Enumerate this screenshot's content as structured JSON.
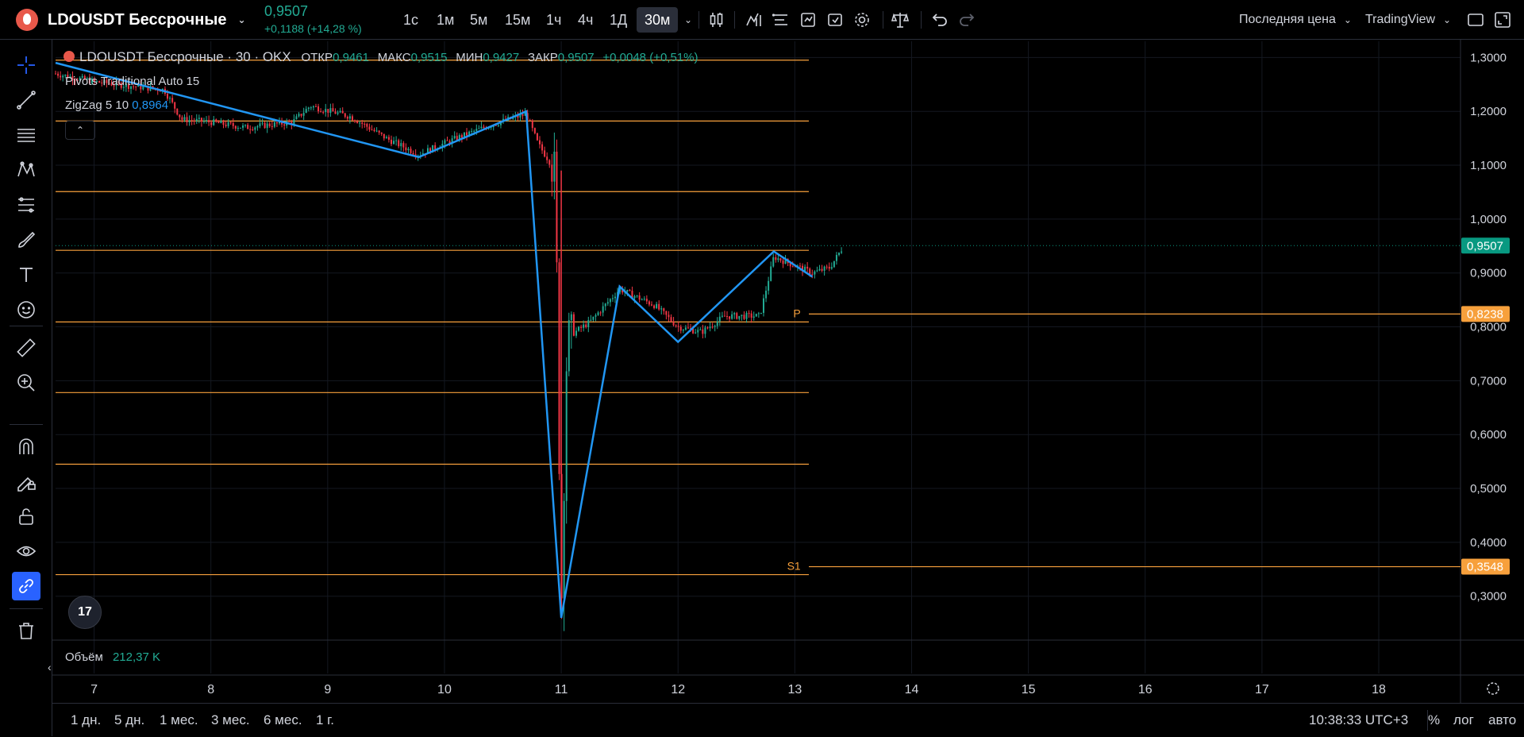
{
  "header": {
    "symbol": "LDOUSDT Бессрочные",
    "price": "0,9507",
    "change": "+0,1188 (+14,28 %)",
    "timeframes": [
      "1с",
      "1м",
      "5м",
      "15м",
      "1ч",
      "4ч",
      "1Д",
      "30м"
    ],
    "active_timeframe": "30м",
    "price_source": "Последняя цена",
    "layout_name": "TradingView"
  },
  "legend": {
    "title": "LDOUSDT Бессрочные · 30 · OKX",
    "open_label": "ОТКР",
    "open": "0,9461",
    "high_label": "МАКС",
    "high": "0,9515",
    "low_label": "МИН",
    "low": "0,9427",
    "close_label": "ЗАКР",
    "close": "0,9507",
    "change": "+0,0048 (+0,51%)"
  },
  "indicators": {
    "pivots": "Pivots Traditional Auto 15",
    "zigzag_label": "ZigZag 5 10",
    "zigzag_value": "0,8964"
  },
  "volume": {
    "label": "Объём",
    "value": "212,37 K"
  },
  "tv_logo": "17",
  "bottom": {
    "ranges": [
      "1 дн.",
      "5 дн.",
      "1 мес.",
      "3 мес.",
      "6 мес.",
      "1 г."
    ],
    "time": "10:38:33 UTC+3",
    "percent": "%",
    "log": "лог",
    "auto": "авто"
  },
  "colors": {
    "up": "#22ab94",
    "down": "#f23645",
    "zigzag": "#2196f3",
    "pivot": "#f7a03c",
    "last_price": "#089981"
  },
  "chart_data": {
    "type": "candlestick",
    "y_axis_ticks": [
      "1,3000",
      "1,2000",
      "1,1000",
      "1,0000",
      "0,9000",
      "0,8000",
      "0,7000",
      "0,6000",
      "0,5000",
      "0,4000",
      "0,3000"
    ],
    "ylim": [
      0.22,
      1.33
    ],
    "x_axis_ticks": [
      "7",
      "8",
      "9",
      "10",
      "11",
      "12",
      "13",
      "14",
      "15",
      "16",
      "17",
      "18"
    ],
    "x_tick_values": [
      7,
      8,
      9,
      10,
      11,
      12,
      13,
      14,
      15,
      16,
      17,
      18
    ],
    "xlim": [
      6.67,
      18.7
    ],
    "pivot_levels": [
      {
        "value": 1.295
      },
      {
        "value": 1.182
      },
      {
        "value": 1.051
      },
      {
        "value": 0.942
      },
      {
        "value": 0.8238,
        "label": "P",
        "price_label": "0,8238"
      },
      {
        "value": 0.678
      },
      {
        "value": 0.545
      },
      {
        "value": 0.3548,
        "label": "S1",
        "price_label": "0,3548"
      }
    ],
    "last_price": {
      "value": 0.9507,
      "label": "0,9507"
    },
    "zigzag": [
      {
        "x": 6.67,
        "y": 1.29
      },
      {
        "x": 8.62,
        "y": 1.18
      },
      {
        "x": 9.78,
        "y": 1.115
      },
      {
        "x": 10.7,
        "y": 1.2
      },
      {
        "x": 11.0,
        "y": 0.26
      },
      {
        "x": 11.5,
        "y": 0.875
      },
      {
        "x": 12.0,
        "y": 0.772
      },
      {
        "x": 12.82,
        "y": 0.94
      },
      {
        "x": 13.15,
        "y": 0.893
      }
    ],
    "price_path": [
      {
        "x": 6.67,
        "y": 1.27
      },
      {
        "x": 7.0,
        "y": 1.255
      },
      {
        "x": 7.6,
        "y": 1.24
      },
      {
        "x": 7.75,
        "y": 1.185
      },
      {
        "x": 8.0,
        "y": 1.18
      },
      {
        "x": 8.3,
        "y": 1.17
      },
      {
        "x": 8.7,
        "y": 1.18
      },
      {
        "x": 8.85,
        "y": 1.21
      },
      {
        "x": 9.2,
        "y": 1.19
      },
      {
        "x": 9.5,
        "y": 1.15
      },
      {
        "x": 9.78,
        "y": 1.12
      },
      {
        "x": 10.1,
        "y": 1.15
      },
      {
        "x": 10.4,
        "y": 1.175
      },
      {
        "x": 10.7,
        "y": 1.195
      },
      {
        "x": 10.8,
        "y": 1.14
      },
      {
        "x": 10.95,
        "y": 1.09
      },
      {
        "x": 11.0,
        "y": 0.27
      },
      {
        "x": 11.05,
        "y": 0.78
      },
      {
        "x": 11.25,
        "y": 0.81
      },
      {
        "x": 11.5,
        "y": 0.87
      },
      {
        "x": 11.8,
        "y": 0.84
      },
      {
        "x": 12.0,
        "y": 0.8
      },
      {
        "x": 12.2,
        "y": 0.79
      },
      {
        "x": 12.4,
        "y": 0.82
      },
      {
        "x": 12.7,
        "y": 0.82
      },
      {
        "x": 12.82,
        "y": 0.93
      },
      {
        "x": 13.15,
        "y": 0.9
      },
      {
        "x": 13.3,
        "y": 0.91
      },
      {
        "x": 13.42,
        "y": 0.9507
      }
    ],
    "title": "LDOUSDT Бессрочные · 30 · OKX"
  }
}
